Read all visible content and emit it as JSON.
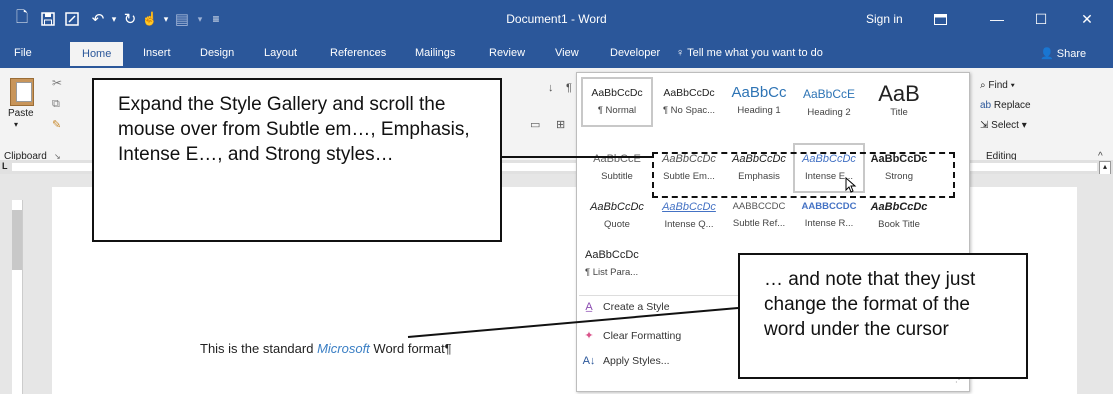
{
  "titlebar": {
    "title": "Document1 - Word",
    "signin": "Sign in",
    "qat_icons": [
      "new-document-icon",
      "save-icon",
      "save-as-icon",
      "undo-icon",
      "redo-icon",
      "touch-mode-icon",
      "highlight-icon",
      "customize-icon"
    ]
  },
  "tabs": [
    "File",
    "Home",
    "Insert",
    "Design",
    "Layout",
    "References",
    "Mailings",
    "Review",
    "View",
    "Developer"
  ],
  "tell_me": "Tell me what you want to do",
  "share": "Share",
  "ribbon": {
    "paste_label": "Paste",
    "clipboard_label": "Clipboard",
    "find_label": "Find",
    "replace_label": "Replace",
    "select_label": "Select",
    "editing_label": "Editing"
  },
  "gallery": {
    "styles": [
      {
        "sample": "AaBbCcDc",
        "name": "¶ Normal"
      },
      {
        "sample": "AaBbCcDc",
        "name": "¶ No Spac..."
      },
      {
        "sample": "AaBbCc",
        "name": "Heading 1"
      },
      {
        "sample": "AaBbCcE",
        "name": "Heading 2"
      },
      {
        "sample": "AaB",
        "name": "Title"
      },
      {
        "sample": "AaBbCcE",
        "name": "Subtitle"
      },
      {
        "sample": "AaBbCcDc",
        "name": "Subtle Em..."
      },
      {
        "sample": "AaBbCcDc",
        "name": "Emphasis"
      },
      {
        "sample": "AaBbCcDc",
        "name": "Intense E..."
      },
      {
        "sample": "AaBbCcDc",
        "name": "Strong"
      },
      {
        "sample": "AaBbCcDc",
        "name": "Quote"
      },
      {
        "sample": "AaBbCcDc",
        "name": "Intense Q..."
      },
      {
        "sample": "AABBCCDC",
        "name": "Subtle Ref..."
      },
      {
        "sample": "AABBCCDC",
        "name": "Intense R..."
      },
      {
        "sample": "AaBbCcDc",
        "name": "Book Title"
      },
      {
        "sample": "AaBbCcDc",
        "name": "¶ List Para..."
      }
    ],
    "menu": [
      "Create a Style",
      "Clear Formatting",
      "Apply Styles..."
    ]
  },
  "document": {
    "text_before": "This is the standard ",
    "word": "Microsoft",
    "text_after": " Word format¶"
  },
  "callouts": {
    "left": "Expand the Style Gallery and scroll the mouse over from Subtle em…, Emphasis, Intense E…, and Strong styles…",
    "right": "… and note that they just change the format of the word under the cursor"
  },
  "colors": {
    "accent": "#2b579a",
    "link_blue": "#3b7fc4"
  }
}
